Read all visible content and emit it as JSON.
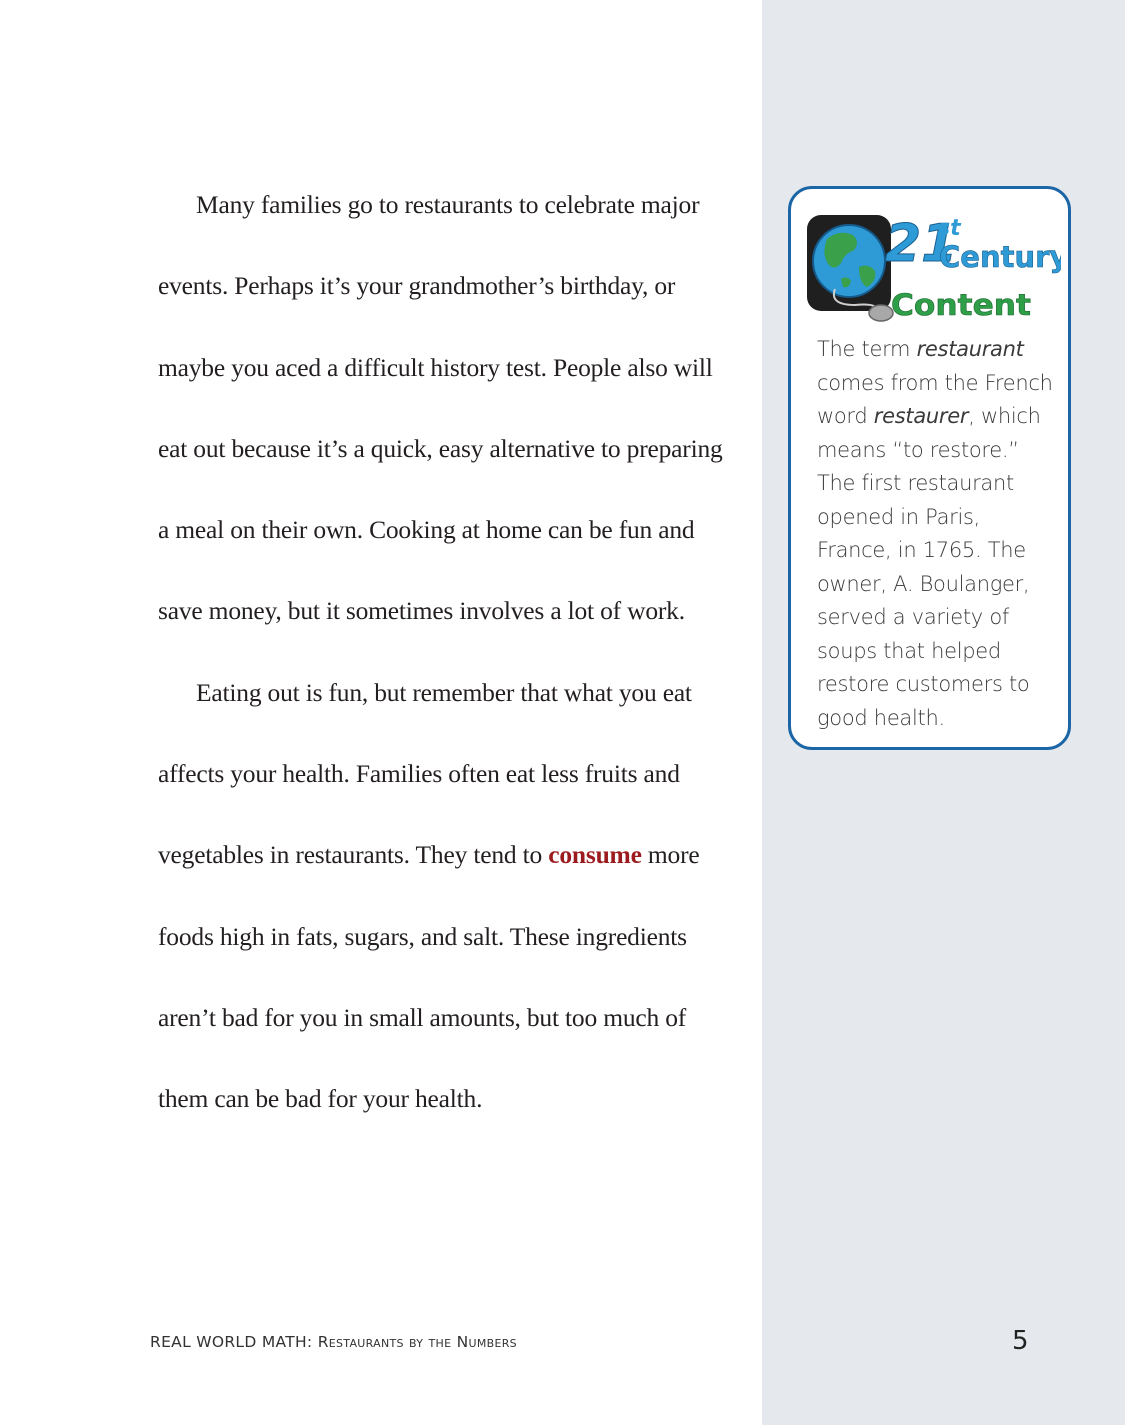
{
  "article": {
    "p1": "Many families go to restaurants to celebrate major events. Perhaps it’s your grandmother’s birthday, or maybe you aced a difficult history test. People also will eat out because it’s a quick, easy alternative to preparing a meal on their own. Cooking at home can be fun and save money, but it sometimes involves a lot of work.",
    "p2_before": "Eating out is fun, but remember that what you eat affects your health. Families often eat less fruits and vegetables in restaurants. They tend to ",
    "p2_vocab": "consume",
    "p2_after": " more foods high in fats, sugars, and salt. These ingredients aren’t bad for you in small amounts, but too much of them can be bad for your health."
  },
  "sidebar": {
    "logo": {
      "icon": "globe-with-computer-mouse-icon",
      "number": "21",
      "suffix": "st",
      "word1": "Century",
      "word2": "Content"
    },
    "text": {
      "t1": "The term ",
      "t2": "restaurant",
      "t3": " comes from the French word ",
      "t4": "restaurer",
      "t5": ", which means “to restore.” The first restaurant opened in Paris, France, in 1765. The owner, A. Boulanger, served a variety of soups that helped restore customers to good health."
    }
  },
  "footer": {
    "series": "REAL WORLD MATH:",
    "title": "Restaurants by the Numbers",
    "page_number": "5"
  },
  "colors": {
    "sidebar_background": "#e5e9ee",
    "box_border": "#1d66a6",
    "vocab_word": "#9b1b1e",
    "logo_blue": "#2e9ad6",
    "logo_green": "#2e9e48"
  }
}
